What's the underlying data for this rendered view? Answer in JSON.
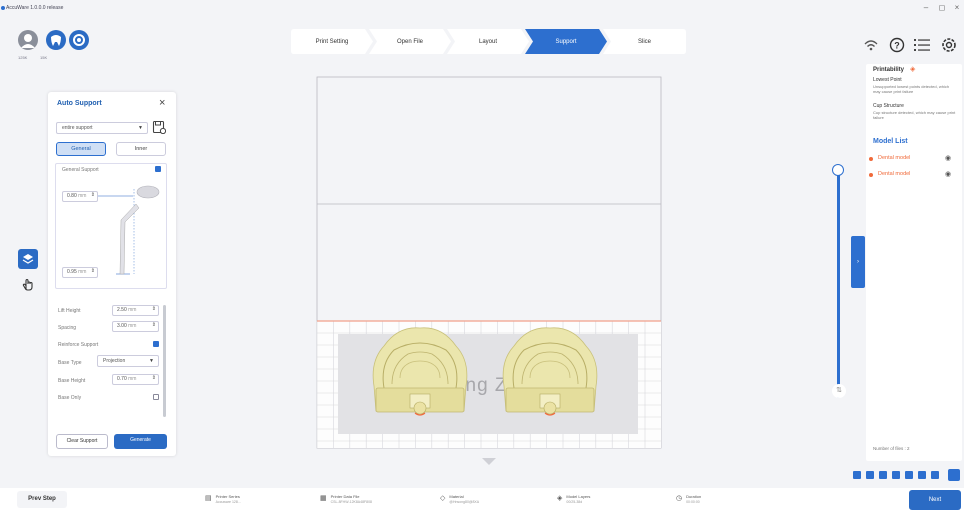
{
  "app": {
    "title": "AccuWare 1.0.0.0 release"
  },
  "window": {
    "minimize": "–",
    "maximize": "◻",
    "close": "×"
  },
  "user": {
    "labels": [
      "125K",
      "15K"
    ]
  },
  "steps": [
    {
      "label": "Print Setting",
      "active": false
    },
    {
      "label": "Open File",
      "active": false
    },
    {
      "label": "Layout",
      "active": false
    },
    {
      "label": "Support",
      "active": true
    },
    {
      "label": "Slice",
      "active": false
    }
  ],
  "top_icons": [
    "wifi-icon",
    "help-icon",
    "list-icon",
    "settings-icon"
  ],
  "auto_support": {
    "title": "Auto Support",
    "mode": "entire support",
    "tabs": [
      "General",
      "Inner"
    ],
    "general_support_label": "General Support",
    "general_support_checked": true,
    "tip_value": "0.80",
    "base_value": "0.95",
    "unit": "mm",
    "fields": [
      {
        "label": "Lift Height",
        "value": "2.50",
        "unit": "mm"
      },
      {
        "label": "Spacing",
        "value": "3.00",
        "unit": "mm"
      }
    ],
    "reinforce_label": "Reinforce Support",
    "reinforce_checked": true,
    "base_type_label": "Base Type",
    "base_type_value": "Projection",
    "base_height_label": "Base Height",
    "base_height_value": "0.70",
    "base_height_unit": "mm",
    "base_only_label": "Base Only",
    "base_only_checked": false,
    "clear_label": "Clear Support",
    "generate_label": "Generate"
  },
  "viewport": {
    "watermark": "Huahang Zhida"
  },
  "right_panel": {
    "printability_title": "Printability",
    "lowest_point_title": "Lowest Point",
    "lowest_point_text": "Unsupported lowest points detected, which may cause print failure",
    "cup_title": "Cup Structure",
    "cup_text": "Cup structure detected, which may cause print failure",
    "model_list_title": "Model List",
    "models": [
      "Dental model",
      "Dental model"
    ],
    "number_of_files": "Number of files : 2"
  },
  "bottom": {
    "prev_label": "Prev Step",
    "next_label": "Next",
    "info": [
      {
        "icon": "printer-icon",
        "title": "Printer Series",
        "value": "Accuware 128..."
      },
      {
        "icon": "file-icon",
        "title": "Printer Data File",
        "value": "CSL-8FHW-12K8A48F808"
      },
      {
        "icon": "material-icon",
        "title": "Material",
        "value": "@Hnsong80@8XA"
      },
      {
        "icon": "layers-icon",
        "title": "Model Layers",
        "value": "00/25-38d"
      },
      {
        "icon": "clock-icon",
        "title": "Duration",
        "value": "00:00:00"
      }
    ]
  },
  "colors": {
    "accent": "#2d6fcf",
    "model": "#e9e5a8",
    "warning": "#f06a3a"
  }
}
